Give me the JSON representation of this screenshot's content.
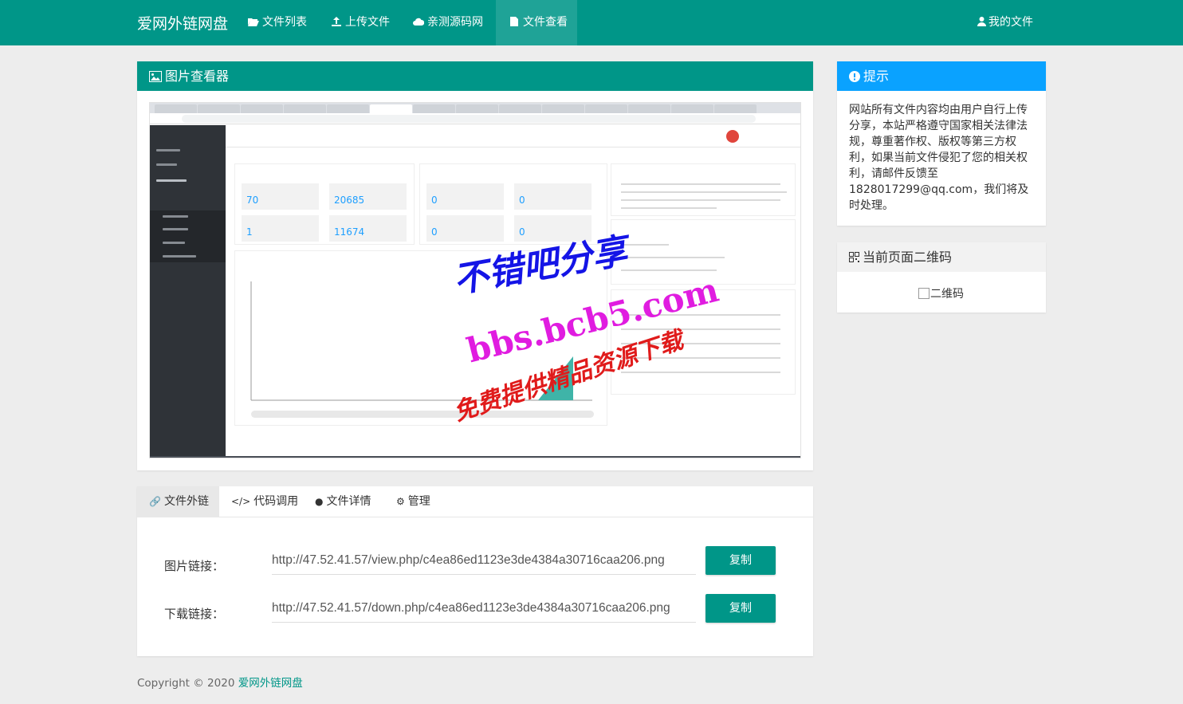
{
  "navbar": {
    "brand": "爱网外链网盘",
    "items": [
      {
        "label": "文件列表",
        "icon": "folder-open-icon"
      },
      {
        "label": "上传文件",
        "icon": "upload-icon"
      },
      {
        "label": "亲测源码网",
        "icon": "cloud-icon"
      },
      {
        "label": "文件查看",
        "icon": "file-icon"
      }
    ],
    "right_label": "我的文件"
  },
  "viewer": {
    "title": "图片查看器",
    "screenshot": {
      "stats_left": [
        "70",
        "20685",
        "1",
        "11674"
      ],
      "stats_right": [
        "0",
        "0",
        "0",
        "0"
      ]
    },
    "watermark": {
      "line1": "不错吧分享",
      "line2": "bbs.bcb5.com",
      "line3": "免费提供精品资源下载"
    }
  },
  "links_panel": {
    "tabs": [
      {
        "label": "文件外链"
      },
      {
        "label": "代码调用"
      },
      {
        "label": "文件详情"
      },
      {
        "label": "管理"
      }
    ],
    "rows": [
      {
        "label": "图片链接：",
        "value": "http://47.52.41.57/view.php/c4ea86ed1123e3de4384a30716caa206.png",
        "button": "复制"
      },
      {
        "label": "下载链接：",
        "value": "http://47.52.41.57/down.php/c4ea86ed1123e3de4384a30716caa206.png",
        "button": "复制"
      }
    ]
  },
  "footer": {
    "copyright": "Copyright © 2020",
    "link": "爱网外链网盘"
  },
  "tip": {
    "title": "提示",
    "body": "网站所有文件内容均由用户自行上传分享，本站严格遵守国家相关法律法规，尊重著作权、版权等第三方权利，如果当前文件侵犯了您的相关权利，请邮件反馈至1828017299@qq.com，我们将及时处理。"
  },
  "qr": {
    "title": "当前页面二维码",
    "alt": "二维码"
  },
  "colors": {
    "primary": "#009688",
    "tip_header": "#0aa2ff",
    "background": "#ededed"
  }
}
